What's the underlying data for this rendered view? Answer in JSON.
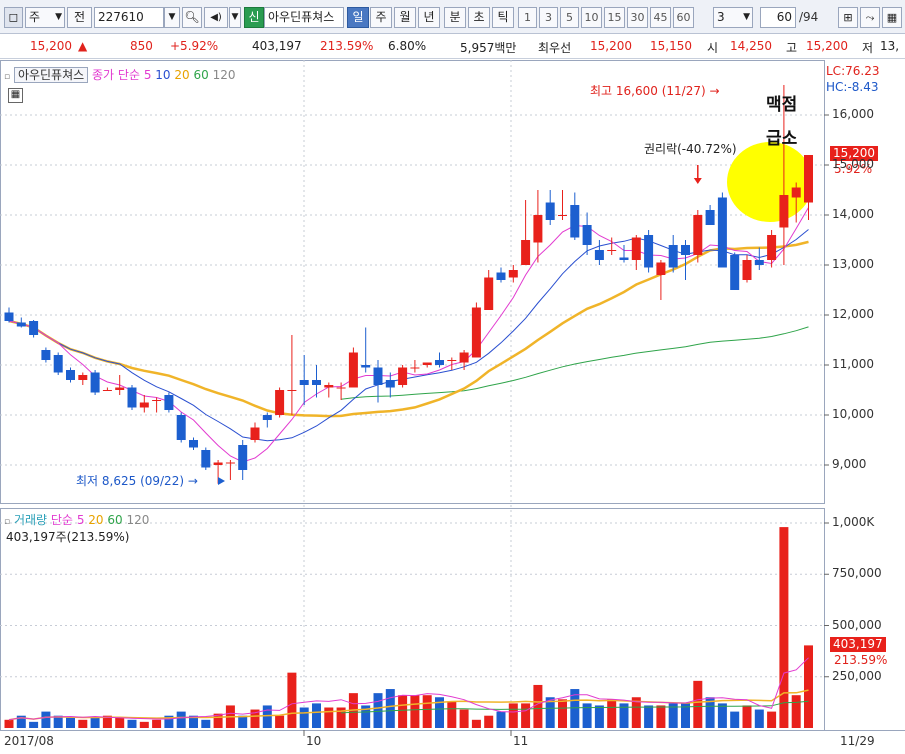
{
  "toolbar": {
    "type_label": "주",
    "prev_label": "전",
    "code": "227610",
    "sin_label": "신",
    "name": "아우딘퓨쳐스",
    "period_tabs": [
      "일",
      "주",
      "월",
      "년",
      "분",
      "초",
      "틱"
    ],
    "selected_tab": "일",
    "intervals": [
      "1",
      "3",
      "5",
      "10",
      "15",
      "30",
      "45",
      "60"
    ],
    "count_select": "3",
    "page_value": "60",
    "page_total": "/94"
  },
  "quote": {
    "price": "15,200",
    "arrow": "▲",
    "change": "850",
    "change_pct": "+5.92%",
    "volume": "403,197",
    "volume_ratio": "213.59%",
    "turnover": "6.80%",
    "amount": "5,957백만",
    "best_label": "최우선",
    "best_ask": "15,200",
    "best_bid": "15,150",
    "open_label": "시",
    "open": "14,250",
    "high_label": "고",
    "high": "15,200",
    "low_label": "저",
    "low": "13,"
  },
  "price_chart": {
    "legend_name": "아우딘퓨쳐스",
    "legend_ma_label": "종가 단순",
    "ma_periods": [
      "5",
      "10",
      "20",
      "60",
      "120"
    ],
    "lc_label": "LC:76.23",
    "hc_label": "HC:-8.43",
    "current_price_tag": "15,200",
    "current_pct_tag": "5.92%",
    "y_ticks": [
      "16,000",
      "15,000",
      "14,000",
      "13,000",
      "12,000",
      "11,000",
      "10,000",
      "9,000"
    ],
    "annotation_high": "최고 16,600 (11/27)",
    "annotation_low": "최저 8,625 (09/22)",
    "annotation_rights": "권리락(-40.72%)",
    "annotation_note_line1": "맥점",
    "annotation_note_line2": "급소"
  },
  "volume_chart": {
    "legend_name": "거래량",
    "legend_ma_label": "단순",
    "ma_periods": [
      "5",
      "20",
      "60",
      "120"
    ],
    "current_label": "403,197주(213.59%)",
    "y_ticks": [
      "1,000K",
      "750,000",
      "500,000",
      "250,000"
    ],
    "current_tag": "403,197",
    "current_pct_tag": "213.59%"
  },
  "x_axis": {
    "labels": [
      "2017/08",
      "10",
      "11"
    ],
    "right_label": "11/29"
  },
  "colors": {
    "up": "#e8211b",
    "down": "#1c5fcf",
    "ma5": "#e23bd0",
    "ma10": "#2a4fd0",
    "ma20": "#f0b429",
    "ma60": "#2fa44a",
    "highlight": "#ffff00"
  },
  "chart_data": {
    "type": "candlestick",
    "candles": [
      [
        12050,
        12150,
        11850,
        11880
      ],
      [
        11850,
        11950,
        11750,
        11770
      ],
      [
        11880,
        11900,
        11550,
        11600
      ],
      [
        11300,
        11350,
        11050,
        11100
      ],
      [
        11200,
        11250,
        10800,
        10850
      ],
      [
        10900,
        10950,
        10650,
        10700
      ],
      [
        10700,
        10850,
        10600,
        10800
      ],
      [
        10850,
        10900,
        10400,
        10450
      ],
      [
        10500,
        10550,
        10500,
        10500
      ],
      [
        10500,
        10800,
        10400,
        10550
      ],
      [
        10550,
        10600,
        10100,
        10150
      ],
      [
        10150,
        10400,
        10050,
        10250
      ],
      [
        10300,
        10350,
        10050,
        10300
      ],
      [
        10400,
        10450,
        10050,
        10100
      ],
      [
        10000,
        10050,
        9450,
        9500
      ],
      [
        9500,
        9550,
        9300,
        9350
      ],
      [
        9300,
        9350,
        8900,
        8950
      ],
      [
        9000,
        9100,
        8625,
        9050
      ],
      [
        9050,
        9100,
        8700,
        9050
      ],
      [
        9400,
        9500,
        8700,
        8900
      ],
      [
        9500,
        9850,
        9450,
        9750
      ],
      [
        10000,
        10050,
        9750,
        9900
      ],
      [
        10000,
        10550,
        9950,
        10500
      ],
      [
        10500,
        11600,
        10000,
        10500
      ],
      [
        10700,
        11200,
        10200,
        10600
      ],
      [
        10700,
        11000,
        10350,
        10600
      ],
      [
        10550,
        10650,
        10350,
        10600
      ],
      [
        10550,
        10650,
        10300,
        10550
      ],
      [
        10550,
        11350,
        10550,
        11250
      ],
      [
        11000,
        11750,
        10850,
        10950
      ],
      [
        10950,
        11100,
        10250,
        10600
      ],
      [
        10700,
        10850,
        10350,
        10550
      ],
      [
        10600,
        11000,
        10550,
        10950
      ],
      [
        10950,
        11100,
        10850,
        10950
      ],
      [
        11000,
        11050,
        10950,
        11050
      ],
      [
        11100,
        11250,
        10950,
        11000
      ],
      [
        11100,
        11150,
        10900,
        11100
      ],
      [
        11050,
        11300,
        10900,
        11250
      ],
      [
        11150,
        12250,
        11150,
        12150
      ],
      [
        12100,
        12900,
        12100,
        12750
      ],
      [
        12850,
        12950,
        12650,
        12700
      ],
      [
        12750,
        13000,
        12650,
        12900
      ],
      [
        13000,
        14300,
        13000,
        13500
      ],
      [
        13450,
        14500,
        13050,
        14000
      ],
      [
        14250,
        14500,
        13800,
        13900
      ],
      [
        14000,
        14500,
        13900,
        14000
      ],
      [
        14200,
        14450,
        13500,
        13550
      ],
      [
        13800,
        14050,
        13200,
        13400
      ],
      [
        13300,
        13500,
        13000,
        13100
      ],
      [
        13300,
        13550,
        13200,
        13300
      ],
      [
        13150,
        13400,
        13050,
        13100
      ],
      [
        13100,
        13600,
        12900,
        13550
      ],
      [
        13600,
        13700,
        12850,
        12950
      ],
      [
        12800,
        13100,
        12300,
        13050
      ],
      [
        13400,
        13600,
        12850,
        12950
      ],
      [
        13400,
        13500,
        12700,
        13200
      ],
      [
        13200,
        14100,
        13050,
        14000
      ],
      [
        14100,
        14200,
        13800,
        13800
      ],
      [
        14350,
        14450,
        13200,
        12950
      ],
      [
        13200,
        13250,
        12500,
        12500
      ],
      [
        12700,
        13200,
        12650,
        13100
      ],
      [
        13100,
        13350,
        12900,
        13000
      ],
      [
        13100,
        13700,
        12950,
        13600
      ],
      [
        13750,
        16600,
        13000,
        14400
      ],
      [
        14350,
        14650,
        13850,
        14550
      ],
      [
        14250,
        15200,
        13900,
        15200
      ]
    ],
    "volumes": [
      40,
      60,
      30,
      80,
      60,
      50,
      40,
      50,
      60,
      50,
      40,
      30,
      40,
      60,
      80,
      60,
      40,
      70,
      110,
      60,
      90,
      110,
      60,
      270,
      100,
      120,
      100,
      100,
      170,
      110,
      170,
      190,
      160,
      160,
      160,
      150,
      130,
      90,
      40,
      60,
      80,
      120,
      120,
      210,
      150,
      140,
      190,
      120,
      110,
      140,
      120,
      150,
      110,
      110,
      120,
      120,
      230,
      150,
      120,
      80,
      110,
      90,
      80,
      980,
      160,
      403
    ]
  }
}
